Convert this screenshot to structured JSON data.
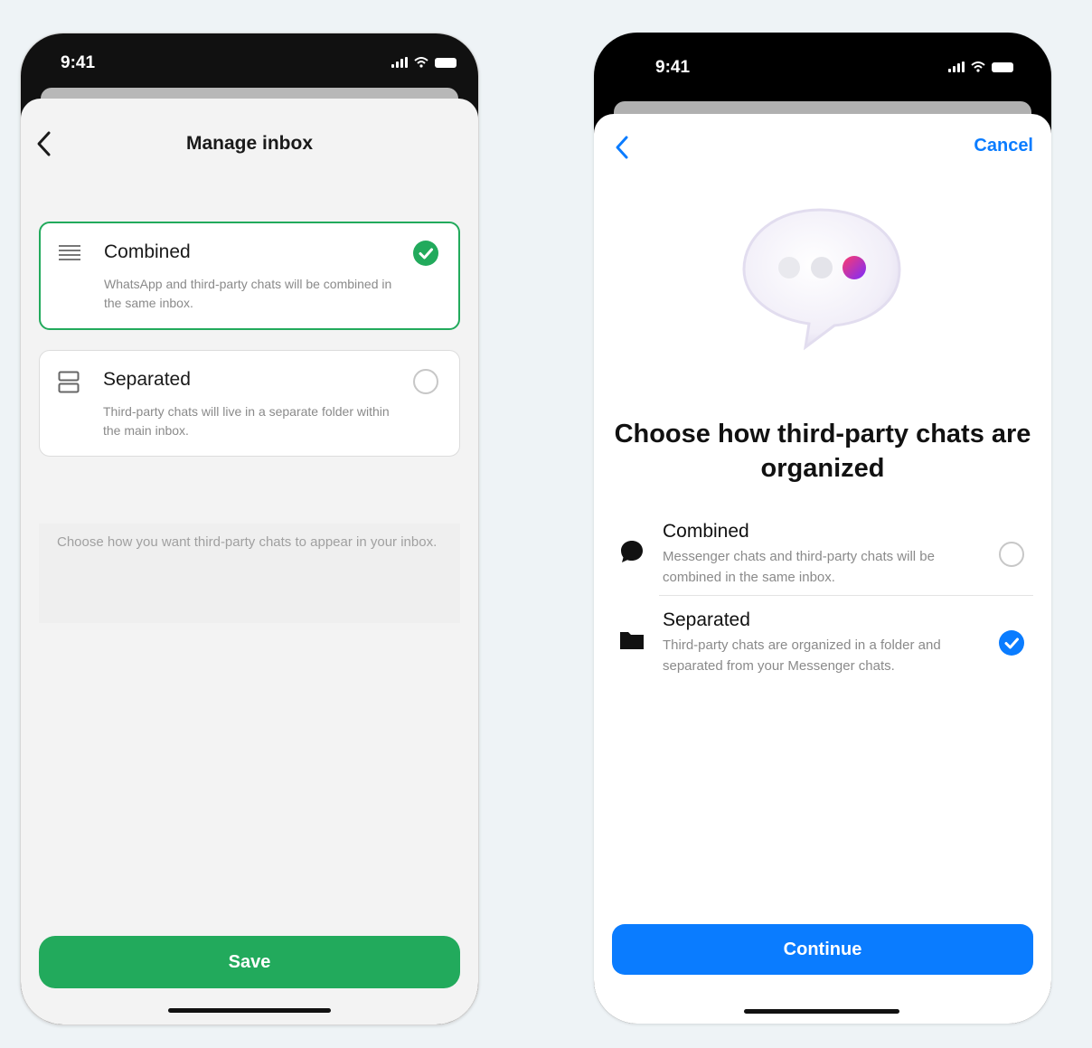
{
  "left_phone": {
    "status_time": "9:41",
    "nav_title": "Manage inbox",
    "options": [
      {
        "title": "Combined",
        "description": "WhatsApp and third-party chats will be combined in the same inbox.",
        "selected": true
      },
      {
        "title": "Separated",
        "description": "Third-party chats will live in a separate folder within the main inbox.",
        "selected": false
      }
    ],
    "footnote": "Choose how you want third-party chats to appear in your inbox.",
    "save_label": "Save"
  },
  "right_phone": {
    "status_time": "9:41",
    "cancel_label": "Cancel",
    "headline": "Choose how third-party chats are organized",
    "options": [
      {
        "title": "Combined",
        "description": "Messenger chats and third-party chats will be combined in the same inbox.",
        "selected": false
      },
      {
        "title": "Separated",
        "description": "Third-party chats are organized in a folder and separated from your Messenger chats.",
        "selected": true
      }
    ],
    "continue_label": "Continue"
  },
  "colors": {
    "whatsapp_green": "#22aa5c",
    "messenger_blue": "#0a7cff"
  },
  "icons": [
    "chevron-left-icon",
    "list-icon",
    "split-rows-icon",
    "checkmark-icon",
    "chat-bubble-icon",
    "folder-icon",
    "signal-icon",
    "wifi-icon",
    "battery-icon"
  ]
}
